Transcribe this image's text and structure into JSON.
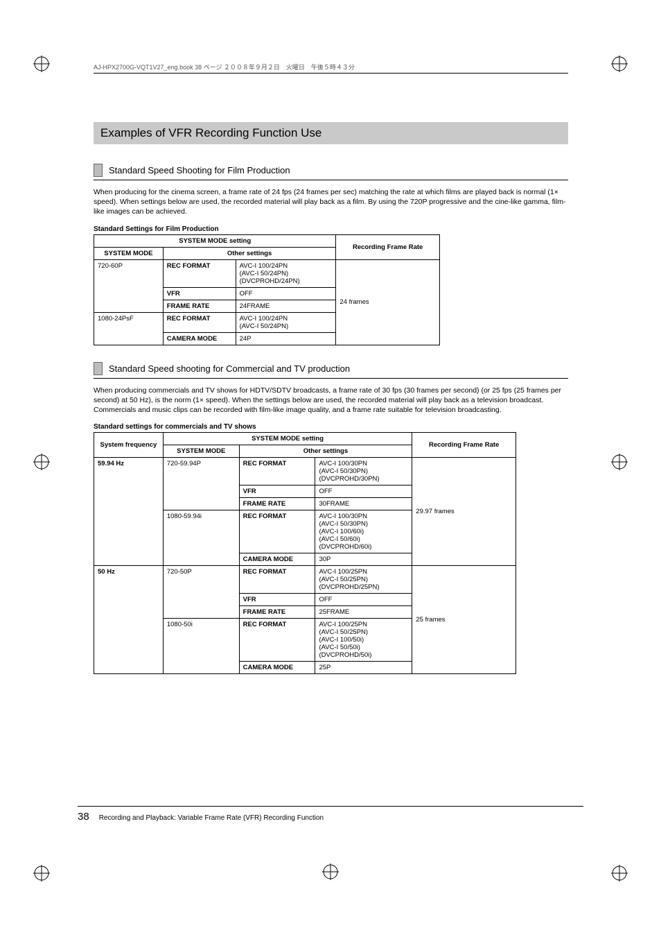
{
  "header_line": "AJ-HPX2700G-VQT1V27_eng.book  38 ページ  ２００８年９月２日　火曜日　午後５時４３分",
  "main_title": "Examples of VFR Recording Function Use",
  "section1": {
    "title": "Standard Speed Shooting for Film Production",
    "para": "When producing for the cinema screen, a frame rate of 24 fps (24 frames per sec) matching the rate at which films are played back is normal (1× speed). When settings below are used, the recorded material will play back as a film. By using the 720P progressive and the cine-like gamma, film-like images can be achieved.",
    "caption": "Standard Settings for Film Production"
  },
  "t1": {
    "h_sysmode_setting": "SYSTEM MODE setting",
    "h_rec_frame_rate": "Recording Frame Rate",
    "h_sysmode": "SYSTEM MODE",
    "h_other": "Other settings",
    "rows": [
      {
        "sysmode": "720-60P",
        "label": "REC FORMAT",
        "value": "AVC-I 100/24PN\n(AVC-I 50/24PN)\n(DVCPROHD/24PN)"
      },
      {
        "label": "VFR",
        "value": "OFF"
      },
      {
        "label": "FRAME RATE",
        "value": "24FRAME"
      },
      {
        "sysmode": "1080-24PsF",
        "label": "REC FORMAT",
        "value": "AVC-I 100/24PN\n(AVC-I 50/24PN)"
      },
      {
        "label": "CAMERA MODE",
        "value": "24P"
      }
    ],
    "rec_rate": "24 frames"
  },
  "section2": {
    "title": "Standard Speed shooting for Commercial and TV production",
    "para": "When producing commercials and TV shows for HDTV/SDTV broadcasts, a frame rate of 30 fps (30 frames per second) (or 25 fps (25 frames per second) at 50 Hz), is the norm (1× speed). When the settings below are used, the recorded material will play back as a television broadcast. Commercials and music clips can be recorded with film-like image quality, and a frame rate suitable for television broadcasting.",
    "caption": "Standard settings for commercials and TV shows"
  },
  "t2": {
    "h_sysfreq": "System frequency",
    "h_sysmode_setting": "SYSTEM MODE setting",
    "h_rec_frame_rate": "Recording Frame Rate",
    "h_sysmode": "SYSTEM MODE",
    "h_other": "Other settings",
    "groups": [
      {
        "freq": "59.94 Hz",
        "rec_rate": "29.97 frames",
        "blocks": [
          {
            "sysmode": "720-59.94P",
            "rows": [
              {
                "label": "REC FORMAT",
                "value": "AVC-I 100/30PN\n(AVC-I 50/30PN)\n(DVCPROHD/30PN)"
              },
              {
                "label": "VFR",
                "value": "OFF"
              },
              {
                "label": "FRAME RATE",
                "value": "30FRAME"
              }
            ]
          },
          {
            "sysmode": "1080-59.94i",
            "rows": [
              {
                "label": "REC FORMAT",
                "value": "AVC-I 100/30PN\n(AVC-I 50/30PN)\n(AVC-I 100/60i)\n(AVC-I 50/60i)\n(DVCPROHD/60i)"
              },
              {
                "label": "CAMERA MODE",
                "value": "30P"
              }
            ]
          }
        ]
      },
      {
        "freq": "50 Hz",
        "rec_rate": "25 frames",
        "blocks": [
          {
            "sysmode": "720-50P",
            "rows": [
              {
                "label": "REC FORMAT",
                "value": "AVC-I 100/25PN\n(AVC-I 50/25PN)\n(DVCPROHD/25PN)"
              },
              {
                "label": "VFR",
                "value": "OFF"
              },
              {
                "label": "FRAME RATE",
                "value": "25FRAME"
              }
            ]
          },
          {
            "sysmode": "1080-50i",
            "rows": [
              {
                "label": "REC FORMAT",
                "value": "AVC-I 100/25PN\n(AVC-I 50/25PN)\n(AVC-I 100/50i)\n(AVC-I 50/50i)\n(DVCPROHD/50i)"
              },
              {
                "label": "CAMERA MODE",
                "value": "25P"
              }
            ]
          }
        ]
      }
    ]
  },
  "footer": {
    "pagenum": "38",
    "breadcrumb": "Recording and Playback: Variable Frame Rate (VFR) Recording Function"
  }
}
